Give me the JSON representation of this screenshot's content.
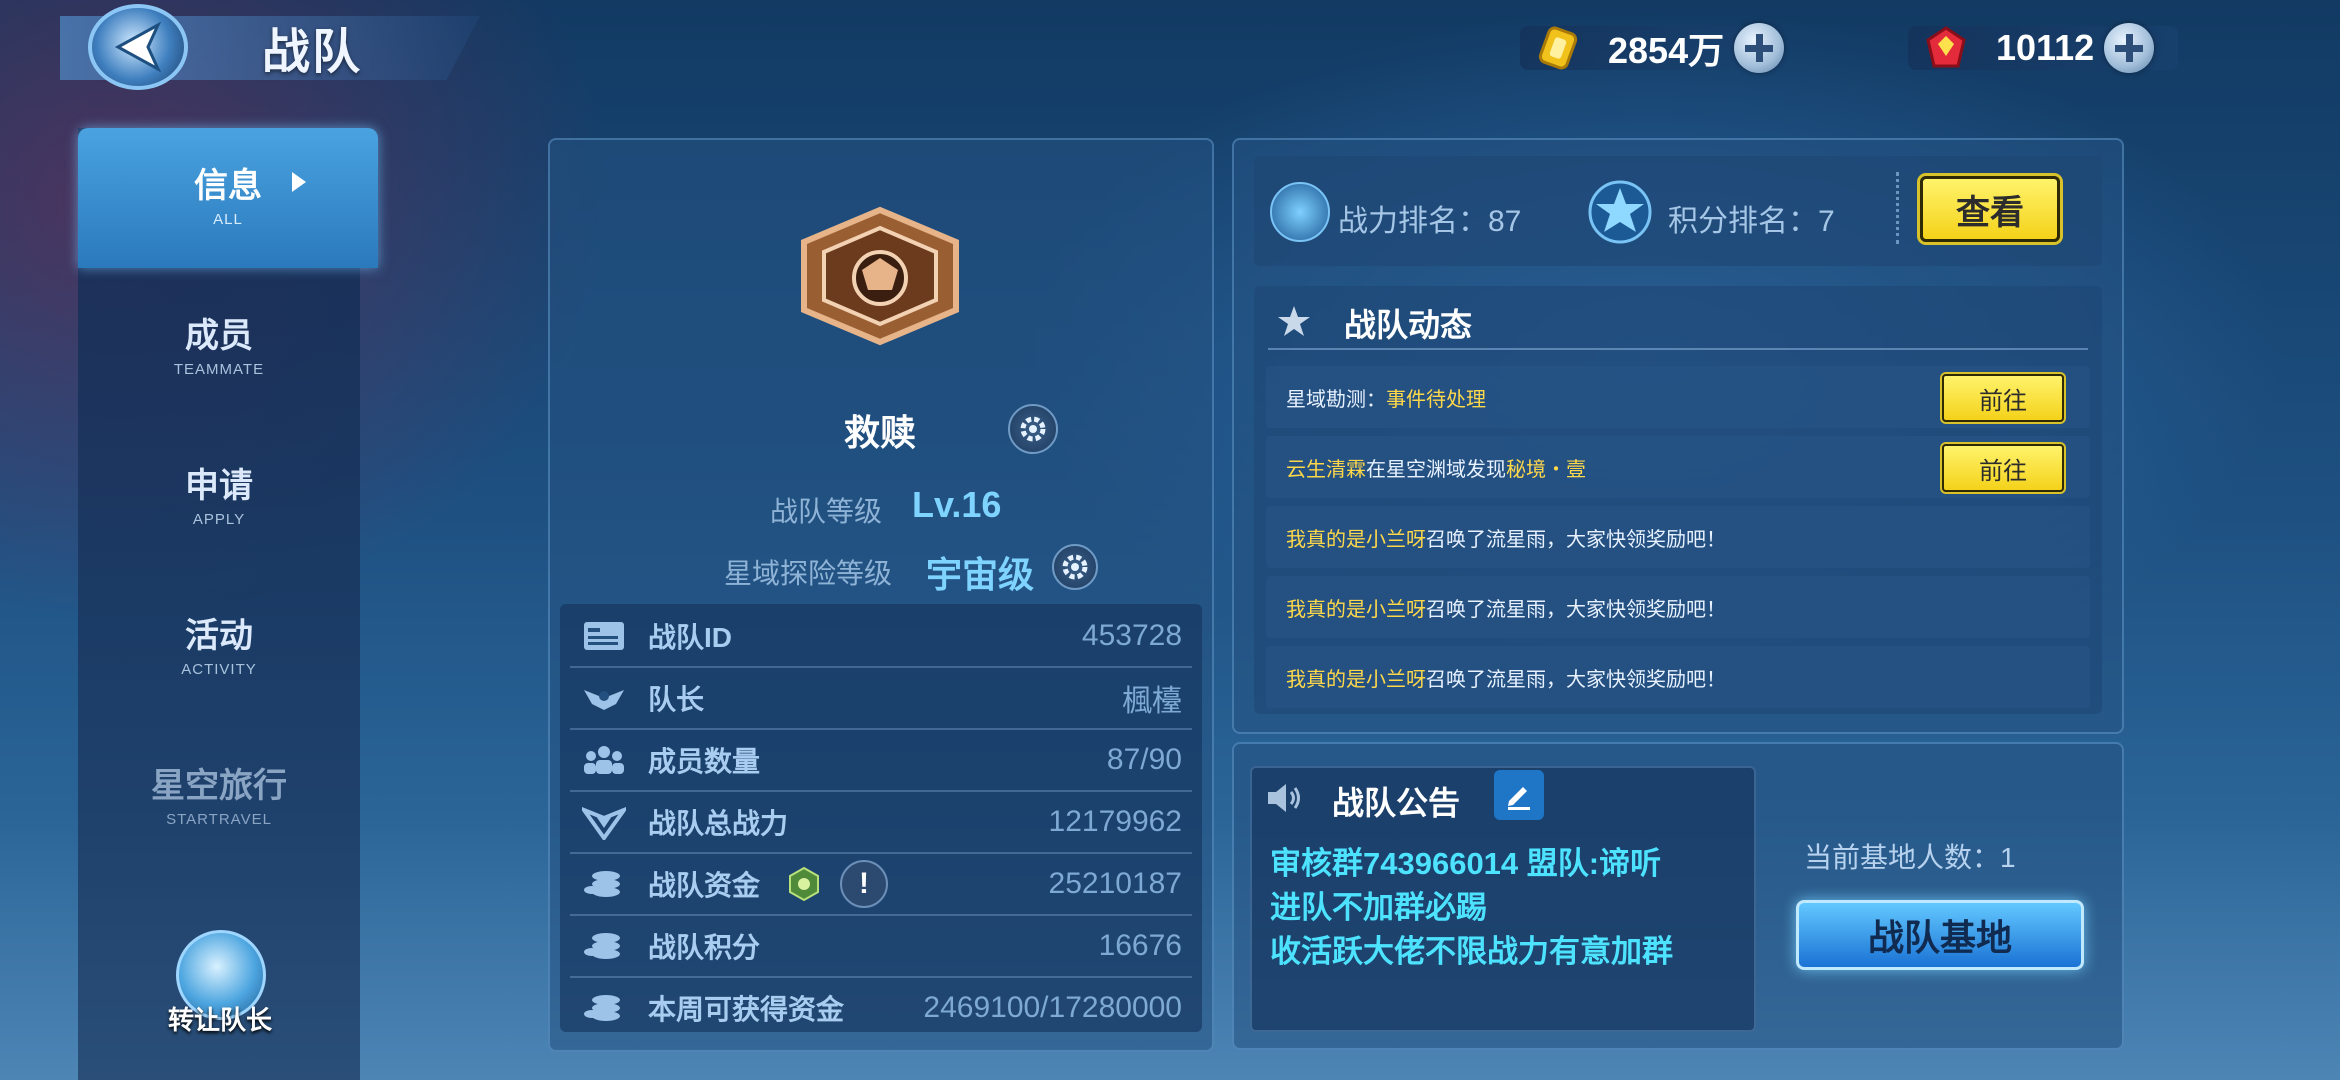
{
  "header": {
    "title": "战队",
    "gold": "2854万",
    "gems": "10112"
  },
  "sidebar": {
    "items": [
      {
        "cn": "信息",
        "en": "ALL"
      },
      {
        "cn": "成员",
        "en": "TEAMMATE"
      },
      {
        "cn": "申请",
        "en": "APPLY"
      },
      {
        "cn": "活动",
        "en": "ACTIVITY"
      },
      {
        "cn": "星空旅行",
        "en": "STARTRAVEL"
      }
    ],
    "transfer_label": "转让队长"
  },
  "team": {
    "name": "救赎",
    "level_label": "战队等级",
    "level_value": "Lv.16",
    "explore_label": "星域探险等级",
    "explore_value": "宇宙级",
    "stats": [
      {
        "label": "战队ID",
        "value": "453728",
        "icon": "id-card-icon"
      },
      {
        "label": "队长",
        "value": "楓檯",
        "icon": "captain-wings-icon"
      },
      {
        "label": "成员数量",
        "value": "87/90",
        "icon": "members-icon"
      },
      {
        "label": "战队总战力",
        "value": "12179962",
        "icon": "power-wings-icon"
      },
      {
        "label": "战队资金",
        "value": "25210187",
        "icon": "coins-icon"
      },
      {
        "label": "战队积分",
        "value": "16676",
        "icon": "coins-icon"
      },
      {
        "label": "本周可获得资金",
        "value": "2469100/17280000",
        "icon": "coins-icon"
      }
    ],
    "warning_symbol": "!"
  },
  "ranking": {
    "power_rank": "战力排名：87",
    "score_rank": "积分排名：7",
    "view_label": "查看"
  },
  "news": {
    "title": "战队动态",
    "go_label": "前往",
    "rows": [
      {
        "a": "星域勘测：",
        "b": "事件待处理",
        "c": ""
      },
      {
        "a": "云生清霖",
        "b": "在星空渊域发现",
        "c": "秘境・壹"
      },
      {
        "a": "我真的是小兰呀",
        "b": "召唤了流星雨，大家快领奖励吧！"
      },
      {
        "a": "我真的是小兰呀",
        "b": "召唤了流星雨，大家快领奖励吧！"
      },
      {
        "a": "我真的是小兰呀",
        "b": "召唤了流星雨，大家快领奖励吧！"
      }
    ]
  },
  "notice": {
    "title": "战队公告",
    "text": "审核群743966014 盟队:谛听\n进队不加群必踢\n收活跃大佬不限战力有意加群"
  },
  "base": {
    "count_label": "当前基地人数：1",
    "button_label": "战队基地"
  },
  "colors": {
    "accent_cyan": "#4de3ff",
    "button_yellow": "#f4d21a",
    "highlight_yellow": "#ffd84a"
  }
}
